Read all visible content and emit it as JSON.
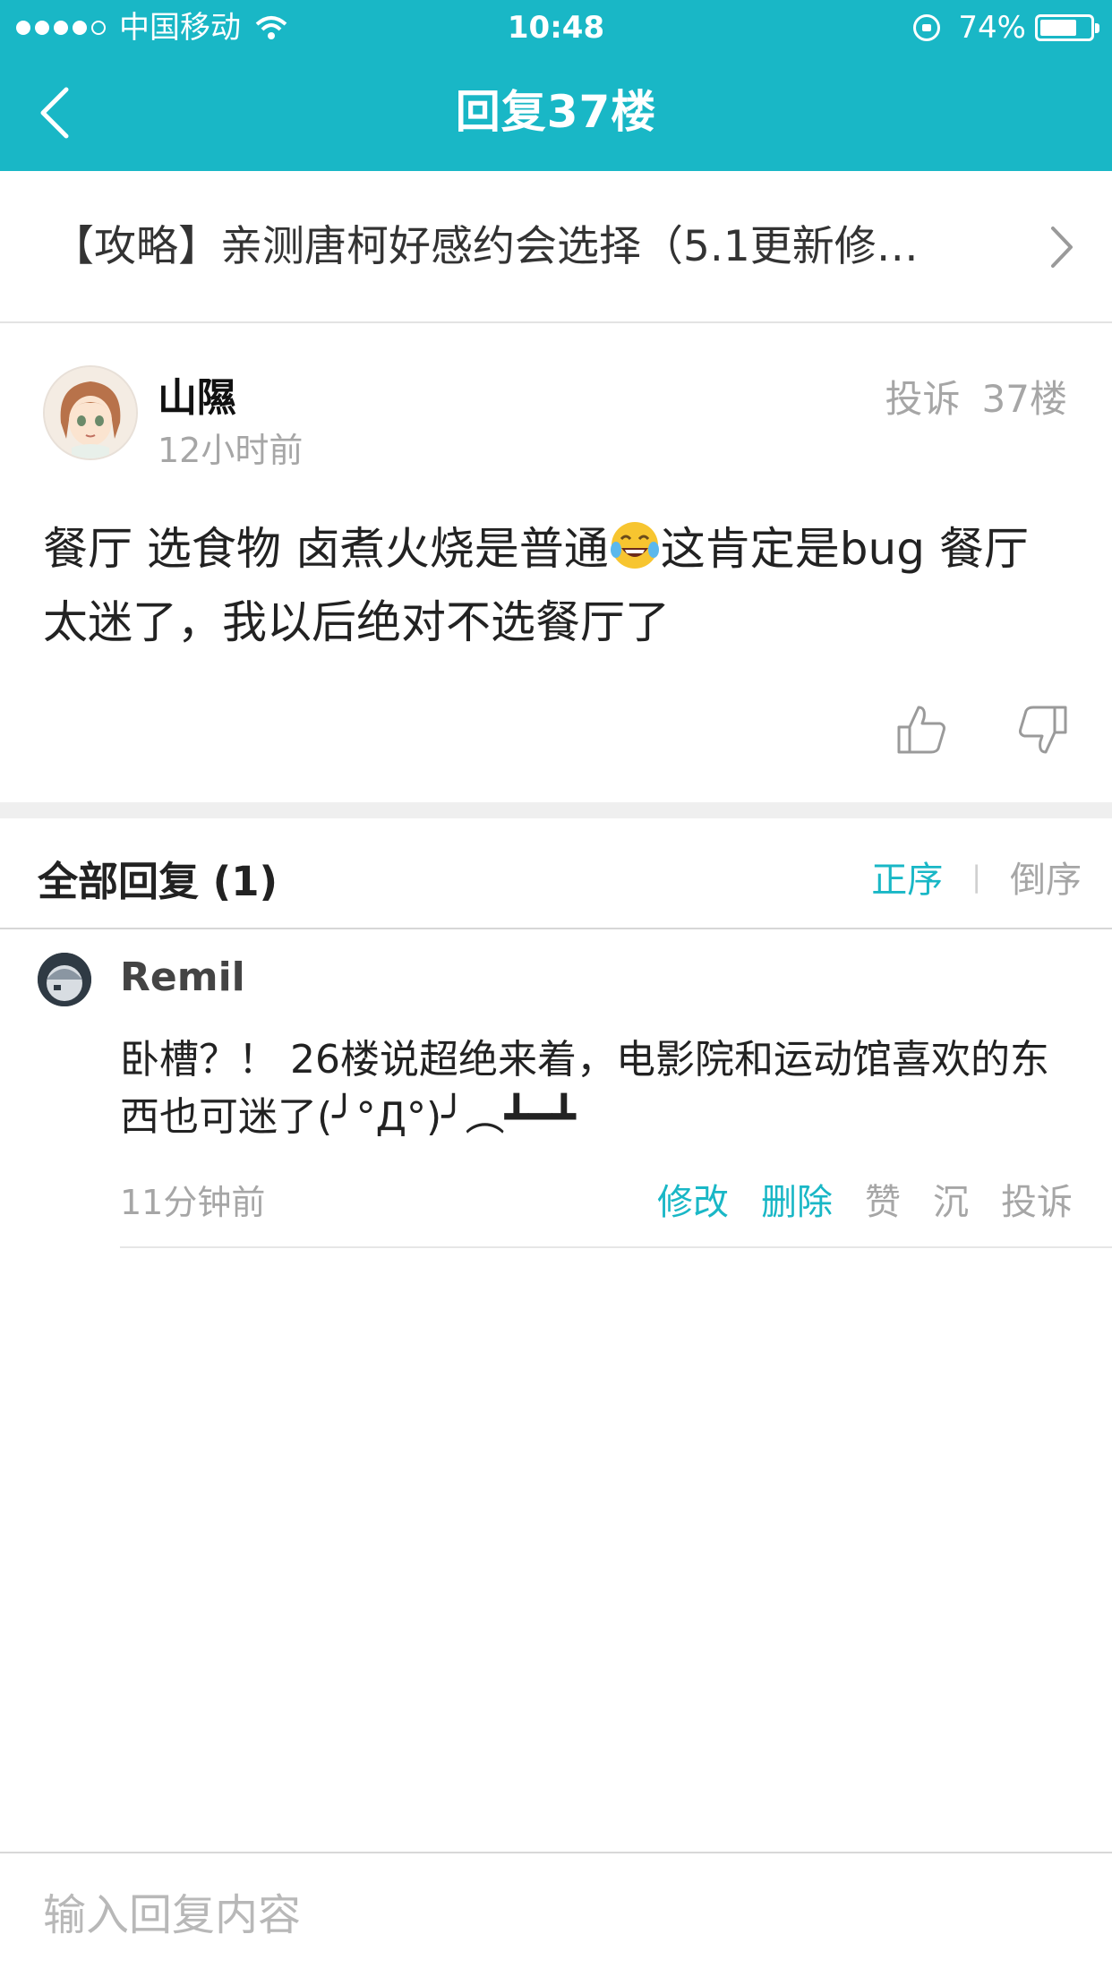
{
  "status_bar": {
    "carrier": "中国移动",
    "time": "10:48",
    "battery": "74%",
    "battery_level": 0.74
  },
  "nav": {
    "title": "回复37楼"
  },
  "thread": {
    "title": "【攻略】亲测唐柯好感约会选择（5.1更新修…"
  },
  "post": {
    "author": "山隰",
    "time": "12小时前",
    "report": "投诉",
    "floor": "37楼",
    "body_before_emoji": "餐厅 选食物 卤煮火烧是普通",
    "body_after_emoji": "这肯定是bug  餐厅太迷了，我以后绝对不选餐厅了"
  },
  "replies": {
    "header": "全部回复 (1)",
    "sort_asc": "正序",
    "sort_desc": "倒序",
    "items": [
      {
        "user": "Remil",
        "body": "卧槽？！ 26楼说超绝来着，电影院和运动馆喜欢的东西也可迷了(╯°Д°)╯︵┻━┻",
        "time": "11分钟前",
        "edit": "修改",
        "delete": "删除",
        "like": "赞",
        "sink": "沉",
        "report": "投诉"
      }
    ]
  },
  "input": {
    "placeholder": "输入回复内容"
  }
}
